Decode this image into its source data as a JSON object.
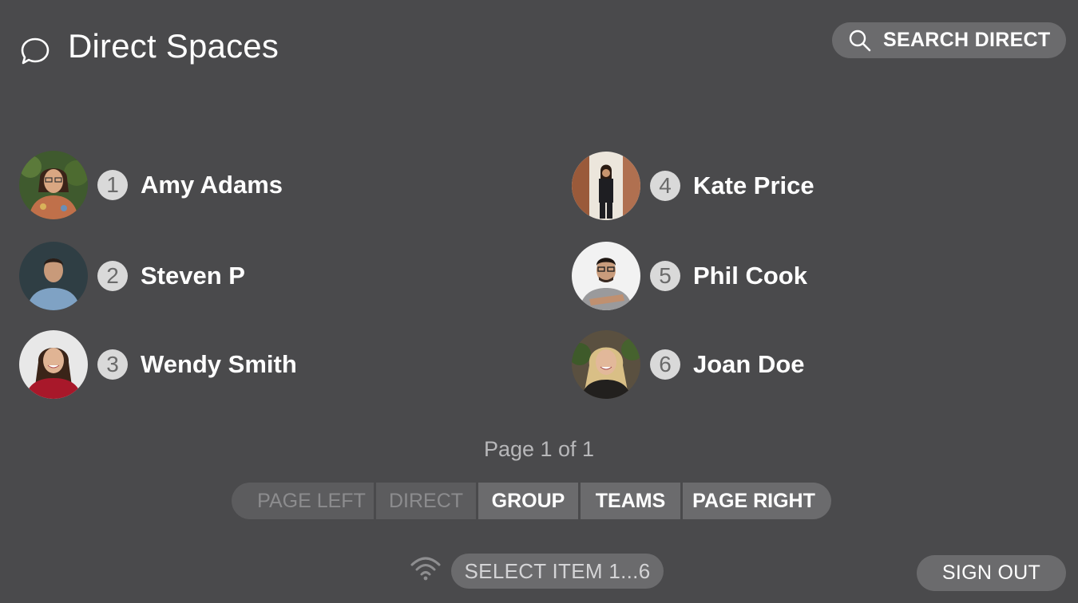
{
  "header": {
    "title": "Direct Spaces",
    "icon": "chat-bubble-icon",
    "search_label": "SEARCH DIRECT",
    "search_icon": "search-icon"
  },
  "contacts": [
    {
      "number": "1",
      "name": "Amy Adams"
    },
    {
      "number": "2",
      "name": "Steven P"
    },
    {
      "number": "3",
      "name": "Wendy Smith"
    },
    {
      "number": "4",
      "name": "Kate Price"
    },
    {
      "number": "5",
      "name": "Phil Cook"
    },
    {
      "number": "6",
      "name": "Joan Doe"
    }
  ],
  "pagination": {
    "indicator": "Page 1 of 1",
    "buttons": [
      "PAGE LEFT",
      "DIRECT",
      "GROUP",
      "TEAMS",
      "PAGE RIGHT"
    ]
  },
  "footer": {
    "wifi_icon": "wifi-icon",
    "select_hint": "SELECT ITEM 1...6",
    "signout_label": "SIGN OUT"
  },
  "colors": {
    "background": "#4a4a4c",
    "button": "#6b6b6d",
    "badge": "#d9d9d9",
    "text": "#ffffff",
    "muted_text": "#8c8c8e"
  }
}
